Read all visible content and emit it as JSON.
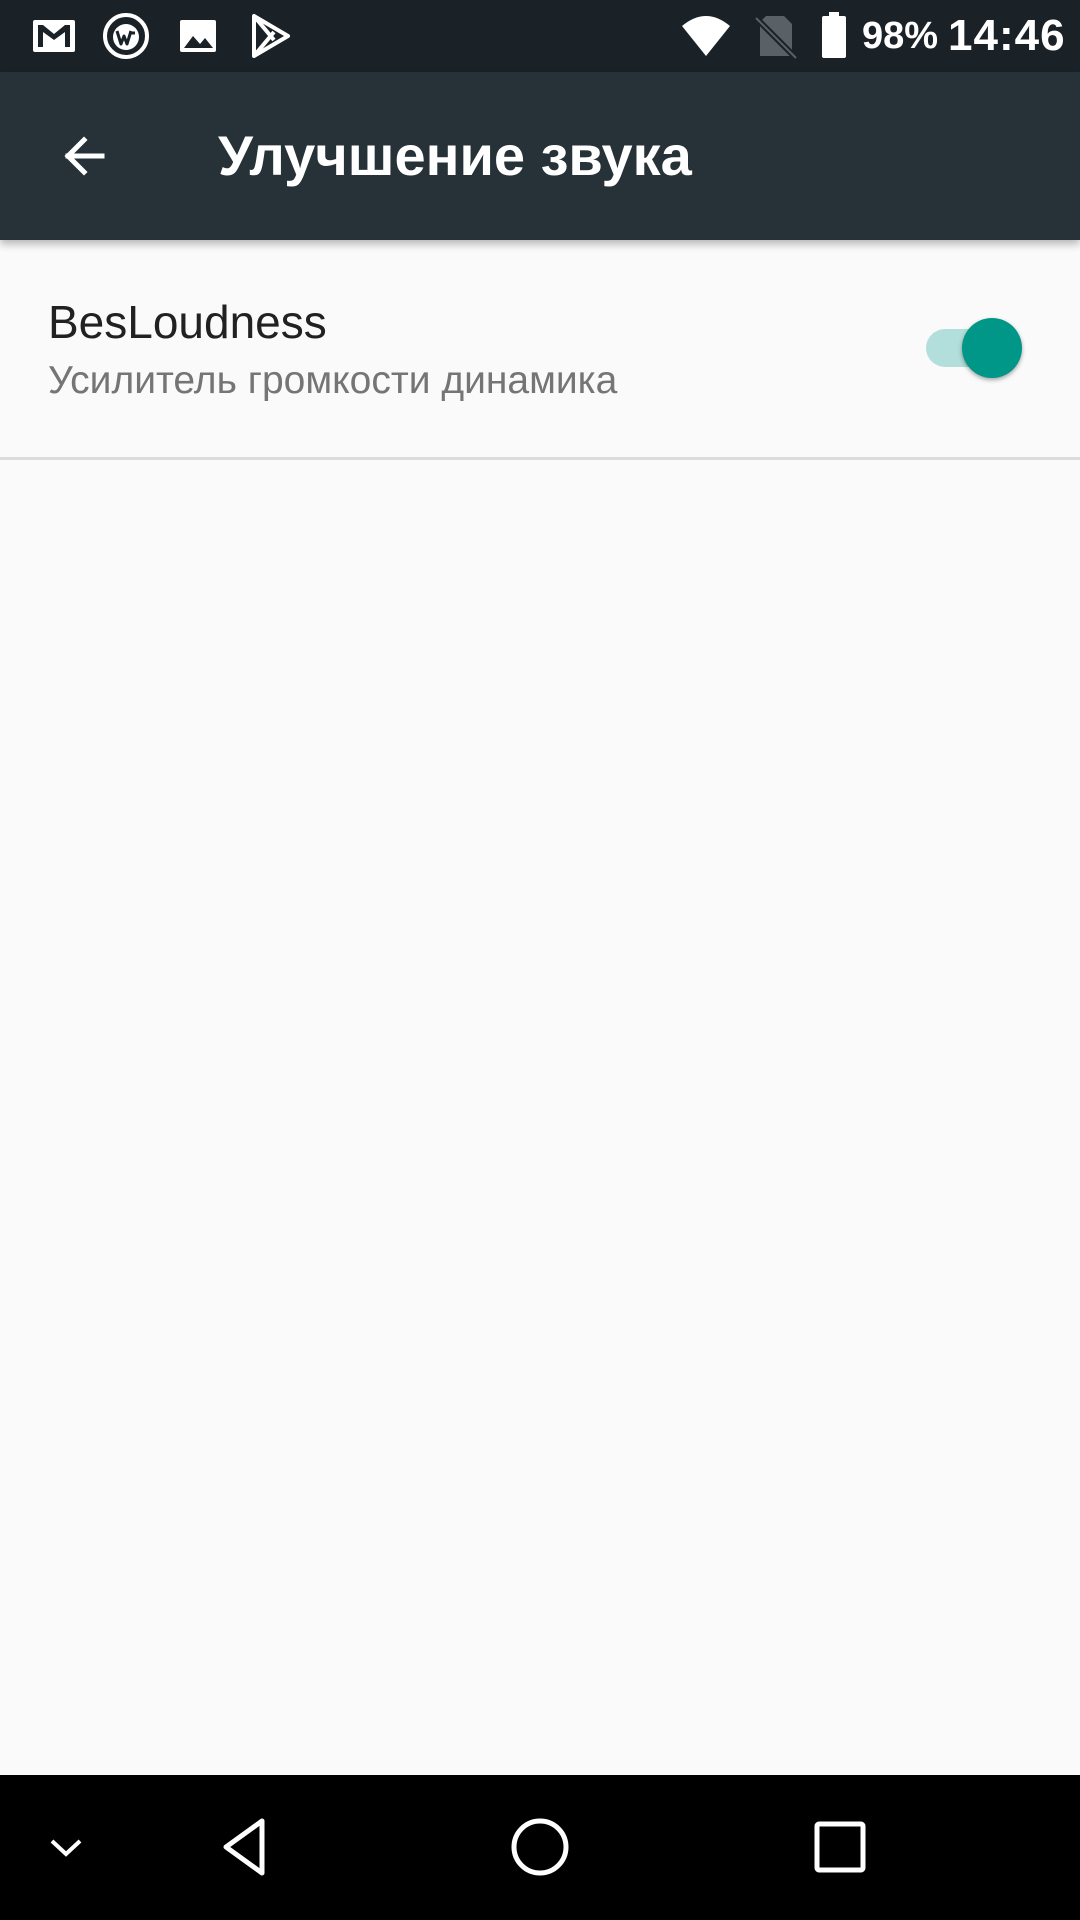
{
  "status_bar": {
    "notification_icons": [
      "gmail-icon",
      "wps-office-icon",
      "gallery-icon",
      "play-store-icon"
    ],
    "system_icons": [
      "wifi-icon",
      "no-sim-icon",
      "battery-icon"
    ],
    "battery_percent": "98%",
    "time": "14:46"
  },
  "app_bar": {
    "back_icon": "arrow-back-icon",
    "title": "Улучшение звука"
  },
  "preferences": [
    {
      "title": "BesLoudness",
      "summary": "Усилитель громкости динамика",
      "switch_on": true
    }
  ],
  "colors": {
    "status_bar": "#1b2227",
    "app_bar": "#263238",
    "background": "#fafafa",
    "accent": "#009688",
    "accent_track": "#b2dfdb"
  },
  "nav_bar": {
    "buttons": [
      "chevron-down-icon",
      "back-triangle-icon",
      "home-circle-icon",
      "recents-square-icon"
    ]
  }
}
